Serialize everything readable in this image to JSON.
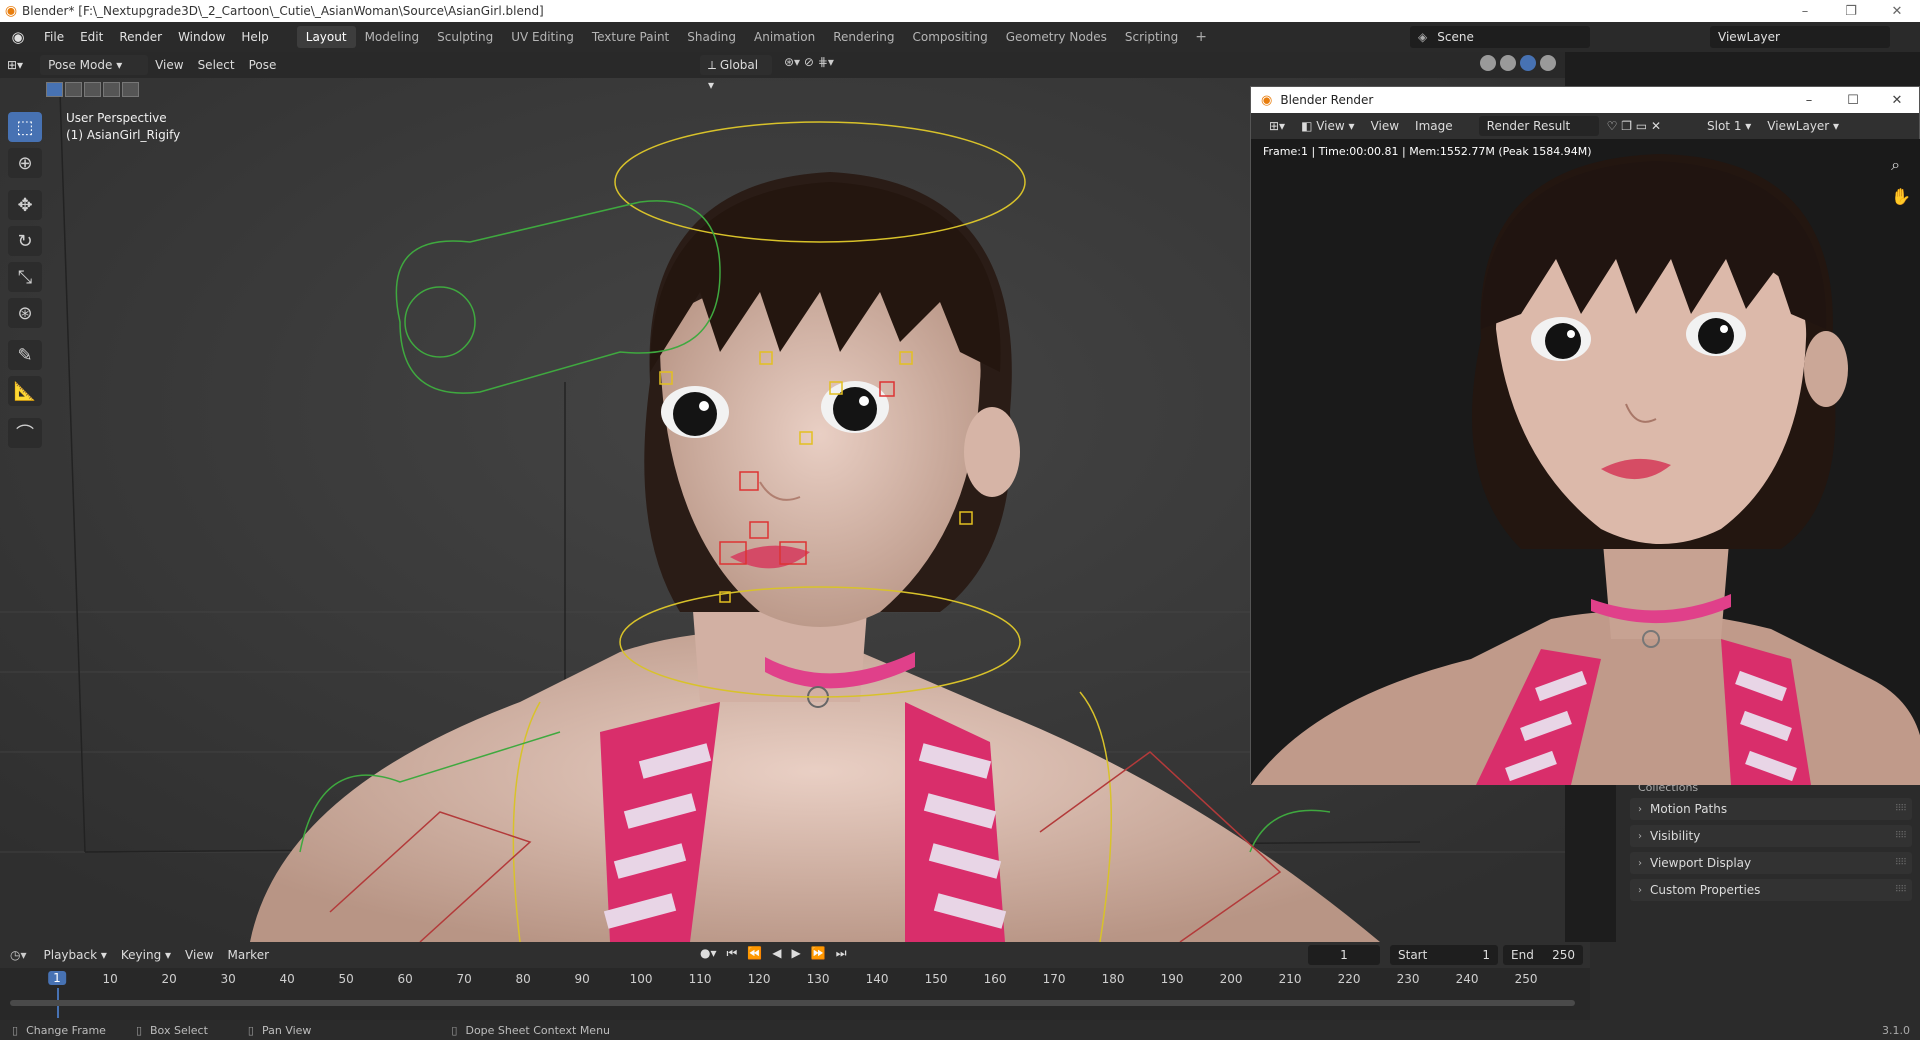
{
  "window": {
    "title": "Blender* [F:\\_Nextupgrade3D\\_2_Cartoon\\_Cutie\\_AsianWoman\\Source\\AsianGirl.blend]",
    "min": "–",
    "max": "❐",
    "close": "✕"
  },
  "menu": [
    "File",
    "Edit",
    "Render",
    "Window",
    "Help"
  ],
  "workspaces": [
    "Layout",
    "Modeling",
    "Sculpting",
    "UV Editing",
    "Texture Paint",
    "Shading",
    "Animation",
    "Rendering",
    "Compositing",
    "Geometry Nodes",
    "Scripting"
  ],
  "active_workspace": "Layout",
  "scene": "Scene",
  "view_layer": "ViewLayer",
  "viewport": {
    "mode": "Pose Mode",
    "menus": [
      "View",
      "Select",
      "Pose"
    ],
    "orientation": "Global",
    "perspective_label": "User Perspective",
    "object_label": "(1) AsianGirl_Rigify"
  },
  "render_window": {
    "title": "Blender Render",
    "menus": [
      "View",
      "View",
      "Image"
    ],
    "image_name": "Render Result",
    "slot": "Slot 1",
    "view_layer": "ViewLayer",
    "info": "Frame:1 | Time:00:00.81 | Mem:1552.77M (Peak 1584.94M)"
  },
  "properties": {
    "partial_label": "Collections",
    "panels": [
      "Motion Paths",
      "Visibility",
      "Viewport Display",
      "Custom Properties"
    ]
  },
  "timeline": {
    "menus": [
      "Playback",
      "Keying",
      "View",
      "Marker"
    ],
    "current_frame": "1",
    "start_label": "Start",
    "start": "1",
    "end_label": "End",
    "end": "250",
    "ticks": [
      "1",
      "10",
      "20",
      "30",
      "40",
      "50",
      "60",
      "70",
      "80",
      "90",
      "100",
      "110",
      "120",
      "130",
      "140",
      "150",
      "160",
      "170",
      "180",
      "190",
      "200",
      "210",
      "220",
      "230",
      "240",
      "250"
    ]
  },
  "statusbar": {
    "items": [
      "Change Frame",
      "Box Select",
      "Pan View",
      "Dope Sheet Context Menu"
    ],
    "version": "3.1.0"
  },
  "colors": {
    "accent": "#4772b3",
    "blender_orange": "#e87d0d"
  }
}
